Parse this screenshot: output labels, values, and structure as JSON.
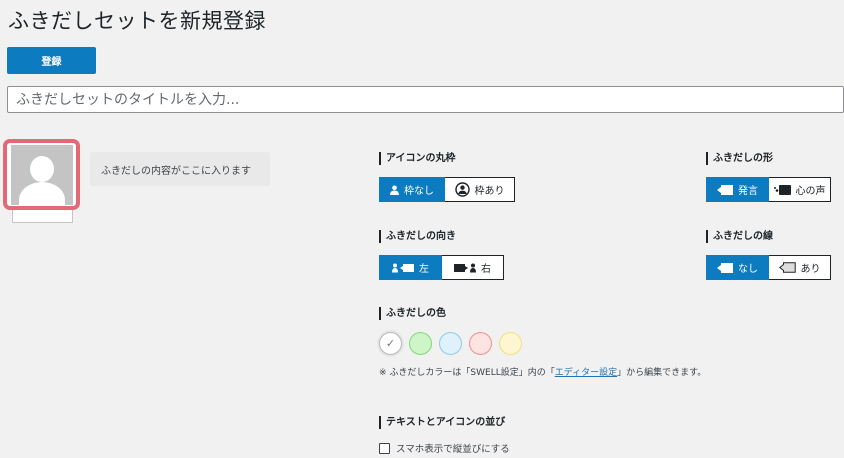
{
  "page": {
    "title": "ふきだしセットを新規登録",
    "save_label": "登録",
    "title_placeholder": "ふきだしセットのタイトルを入力..."
  },
  "preview": {
    "bubble_text": "ふきだしの内容がここに入ります"
  },
  "icon_border": {
    "title": "アイコンの丸枠",
    "options": [
      "枠なし",
      "枠あり"
    ],
    "selected": "枠なし"
  },
  "direction": {
    "title": "ふきだしの向き",
    "options": [
      "左",
      "右"
    ],
    "selected": "左"
  },
  "shape": {
    "title": "ふきだしの形",
    "options": [
      "発言",
      "心の声"
    ],
    "selected": "発言"
  },
  "line": {
    "title": "ふきだしの線",
    "options": [
      "なし",
      "あり"
    ],
    "selected": "なし"
  },
  "color": {
    "title": "ふきだしの色",
    "swatches": [
      {
        "name": "default",
        "fill": "#ffffff",
        "border": "#b8b8b8",
        "selected": true
      },
      {
        "name": "green",
        "fill": "#cdf5c8",
        "border": "#7fd877"
      },
      {
        "name": "blue",
        "fill": "#dff1fb",
        "border": "#8fcbe8"
      },
      {
        "name": "red",
        "fill": "#fde4e2",
        "border": "#ef8f8b"
      },
      {
        "name": "yellow",
        "fill": "#fdf6d0",
        "border": "#f2de86"
      }
    ],
    "note_prefix": "※ ふきだしカラーは「SWELL設定」内の「",
    "note_link": "エディター設定",
    "note_suffix": "」から編集できます。"
  },
  "layout": {
    "title": "テキストとアイコンの並び",
    "checkbox_label": "スマホ表示で縦並びにする",
    "checked": false
  },
  "colors": {
    "accent": "#0d7bbf",
    "avatar_frame": "#e06a76"
  }
}
